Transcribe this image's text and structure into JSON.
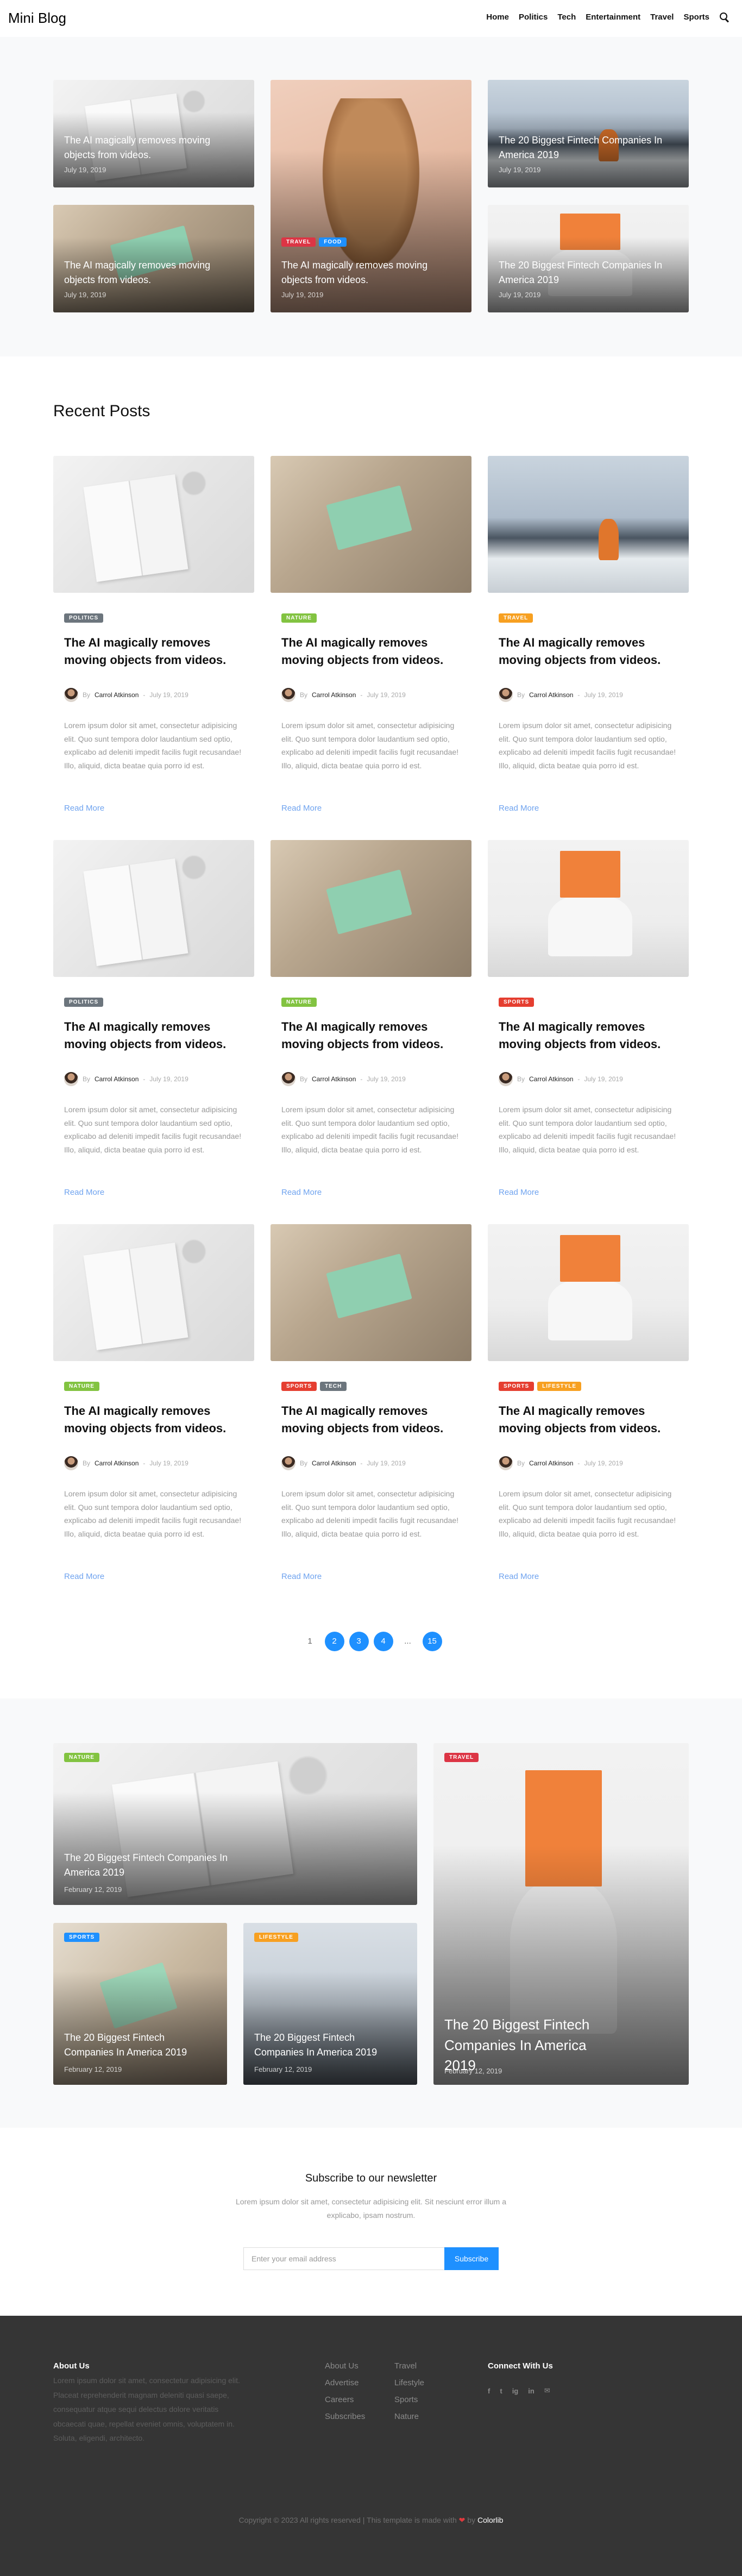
{
  "header": {
    "logo": "Mini Blog",
    "nav": [
      "Home",
      "Politics",
      "Tech",
      "Entertainment",
      "Travel",
      "Sports"
    ]
  },
  "hero": {
    "cards": [
      {
        "title": "The AI magically removes moving objects from videos.",
        "date": "July 19, 2019"
      },
      {
        "title": "The AI magically removes moving objects from videos.",
        "date": "July 19, 2019"
      },
      {
        "title": "The AI magically removes moving objects from videos.",
        "date": "July 19, 2019",
        "tags": [
          "Travel",
          "Food"
        ]
      },
      {
        "title": "The 20 Biggest Fintech Companies In America 2019",
        "date": "July 19, 2019"
      },
      {
        "title": "The 20 Biggest Fintech Companies In America 2019",
        "date": "July 19, 2019"
      }
    ]
  },
  "recent": {
    "heading": "Recent Posts",
    "posts": [
      {
        "tags": [
          "Politics"
        ],
        "title": "The AI magically removes moving objects from videos.",
        "by": "By",
        "author": "Carrol Atkinson",
        "date": "July 19, 2019",
        "excerpt": "Lorem ipsum dolor sit amet, consectetur adipisicing elit. Quo sunt tempora dolor laudantium sed optio, explicabo ad deleniti impedit facilis fugit recusandae! Illo, aliquid, dicta beatae quia porro id est.",
        "more": "Read More"
      },
      {
        "tags": [
          "Nature"
        ],
        "title": "The AI magically removes moving objects from videos.",
        "by": "By",
        "author": "Carrol Atkinson",
        "date": "July 19, 2019",
        "excerpt": "Lorem ipsum dolor sit amet, consectetur adipisicing elit. Quo sunt tempora dolor laudantium sed optio, explicabo ad deleniti impedit facilis fugit recusandae! Illo, aliquid, dicta beatae quia porro id est.",
        "more": "Read More"
      },
      {
        "tags": [
          "Travel"
        ],
        "title": "The AI magically removes moving objects from videos.",
        "by": "By",
        "author": "Carrol Atkinson",
        "date": "July 19, 2019",
        "excerpt": "Lorem ipsum dolor sit amet, consectetur adipisicing elit. Quo sunt tempora dolor laudantium sed optio, explicabo ad deleniti impedit facilis fugit recusandae! Illo, aliquid, dicta beatae quia porro id est.",
        "more": "Read More"
      },
      {
        "tags": [
          "Politics"
        ],
        "title": "The AI magically removes moving objects from videos.",
        "by": "By",
        "author": "Carrol Atkinson",
        "date": "July 19, 2019",
        "excerpt": "Lorem ipsum dolor sit amet, consectetur adipisicing elit. Quo sunt tempora dolor laudantium sed optio, explicabo ad deleniti impedit facilis fugit recusandae! Illo, aliquid, dicta beatae quia porro id est.",
        "more": "Read More"
      },
      {
        "tags": [
          "Nature"
        ],
        "title": "The AI magically removes moving objects from videos.",
        "by": "By",
        "author": "Carrol Atkinson",
        "date": "July 19, 2019",
        "excerpt": "Lorem ipsum dolor sit amet, consectetur adipisicing elit. Quo sunt tempora dolor laudantium sed optio, explicabo ad deleniti impedit facilis fugit recusandae! Illo, aliquid, dicta beatae quia porro id est.",
        "more": "Read More"
      },
      {
        "tags": [
          "Sports"
        ],
        "title": "The AI magically removes moving objects from videos.",
        "by": "By",
        "author": "Carrol Atkinson",
        "date": "July 19, 2019",
        "excerpt": "Lorem ipsum dolor sit amet, consectetur adipisicing elit. Quo sunt tempora dolor laudantium sed optio, explicabo ad deleniti impedit facilis fugit recusandae! Illo, aliquid, dicta beatae quia porro id est.",
        "more": "Read More"
      },
      {
        "tags": [
          "Nature"
        ],
        "title": "The AI magically removes moving objects from videos.",
        "by": "By",
        "author": "Carrol Atkinson",
        "date": "July 19, 2019",
        "excerpt": "Lorem ipsum dolor sit amet, consectetur adipisicing elit. Quo sunt tempora dolor laudantium sed optio, explicabo ad deleniti impedit facilis fugit recusandae! Illo, aliquid, dicta beatae quia porro id est.",
        "more": "Read More"
      },
      {
        "tags": [
          "Sports",
          "Tech"
        ],
        "title": "The AI magically removes moving objects from videos.",
        "by": "By",
        "author": "Carrol Atkinson",
        "date": "July 19, 2019",
        "excerpt": "Lorem ipsum dolor sit amet, consectetur adipisicing elit. Quo sunt tempora dolor laudantium sed optio, explicabo ad deleniti impedit facilis fugit recusandae! Illo, aliquid, dicta beatae quia porro id est.",
        "more": "Read More"
      },
      {
        "tags": [
          "Sports",
          "Lifestyle"
        ],
        "title": "The AI magically removes moving objects from videos.",
        "by": "By",
        "author": "Carrol Atkinson",
        "date": "July 19, 2019",
        "excerpt": "Lorem ipsum dolor sit amet, consectetur adipisicing elit. Quo sunt tempora dolor laudantium sed optio, explicabo ad deleniti impedit facilis fugit recusandae! Illo, aliquid, dicta beatae quia porro id est.",
        "more": "Read More"
      }
    ]
  },
  "pagination": {
    "pages": [
      "1",
      "2",
      "3",
      "4",
      "...",
      "15"
    ],
    "active": [
      "2",
      "3",
      "4",
      "15"
    ]
  },
  "featured": {
    "cards": [
      {
        "tag": "Nature",
        "title": "The 20 Biggest Fintech Companies In America 2019",
        "date": "February 12, 2019"
      },
      {
        "tag": "Sports",
        "title": "The 20 Biggest Fintech Companies In America 2019",
        "date": "February 12, 2019"
      },
      {
        "tag": "Lifestyle",
        "title": "The 20 Biggest Fintech Companies In America 2019",
        "date": "February 12, 2019"
      },
      {
        "tag": "Travel",
        "title": "The 20 Biggest Fintech Companies In America 2019",
        "date": "February 12, 2019"
      }
    ]
  },
  "newsletter": {
    "heading": "Subscribe to our newsletter",
    "text": "Lorem ipsum dolor sit amet, consectetur adipisicing elit. Sit nesciunt error illum a explicabo, ipsam nostrum.",
    "placeholder": "Enter your email address",
    "button": "Subscribe"
  },
  "footer": {
    "about_heading": "About Us",
    "about_text": "Lorem ipsum dolor sit amet, consectetur adipisicing elit. Placeat reprehenderit magnam deleniti quasi saepe, consequatur atque sequi delectus dolore veritatis obcaecati quae, repellat eveniet omnis, voluptatem in. Soluta, eligendi, architecto.",
    "links_col1": [
      "About Us",
      "Advertise",
      "Careers",
      "Subscribes"
    ],
    "links_col2": [
      "Travel",
      "Lifestyle",
      "Sports",
      "Nature"
    ],
    "connect_heading": "Connect With Us",
    "social": [
      "f",
      "t",
      "ig",
      "in",
      "✉"
    ],
    "copyright_prefix": "Copyright © 2023 All rights reserved | This template is made with",
    "heart": "❤",
    "by": "by",
    "brand": "Colorlib"
  },
  "colors": {
    "accent": "#1e90ff",
    "footer_bg": "#353535",
    "band_bg": "#f8f9fa"
  }
}
